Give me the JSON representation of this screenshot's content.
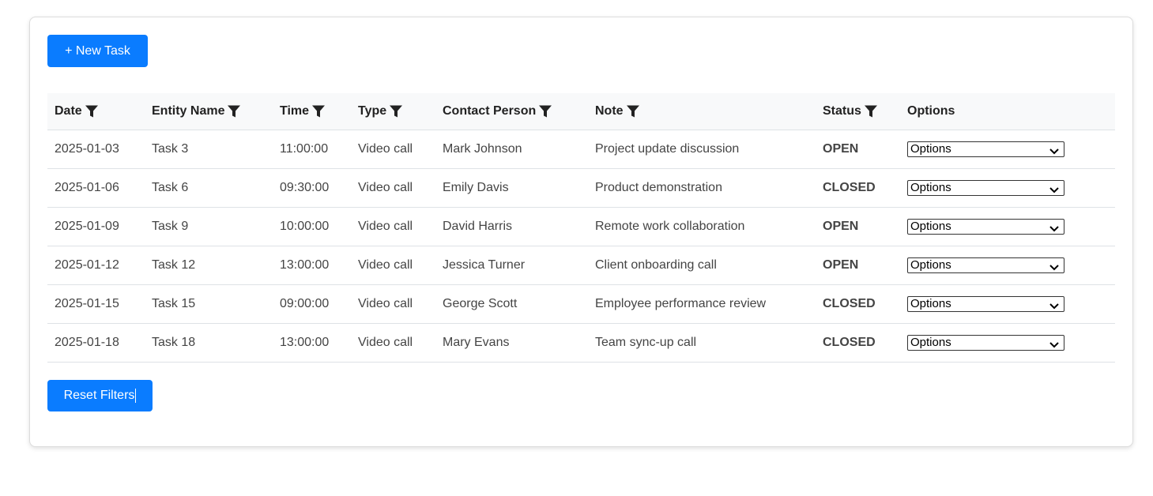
{
  "toolbar": {
    "new_task_label": "+ New Task",
    "reset_label": "Reset Filters"
  },
  "table": {
    "headers": [
      {
        "label": "Date",
        "filter": true
      },
      {
        "label": "Entity Name",
        "filter": true
      },
      {
        "label": "Time",
        "filter": true
      },
      {
        "label": "Type",
        "filter": true
      },
      {
        "label": "Contact Person",
        "filter": true
      },
      {
        "label": "Note",
        "filter": true
      },
      {
        "label": "Status",
        "filter": true
      },
      {
        "label": "Options",
        "filter": false
      }
    ],
    "rows": [
      {
        "date": "2025-01-03",
        "entity": "Task 3",
        "time": "11:00:00",
        "type": "Video call",
        "contact": "Mark Johnson",
        "note": "Project update discussion",
        "status": "OPEN",
        "option": "Options"
      },
      {
        "date": "2025-01-06",
        "entity": "Task 6",
        "time": "09:30:00",
        "type": "Video call",
        "contact": "Emily Davis",
        "note": "Product demonstration",
        "status": "CLOSED",
        "option": "Options"
      },
      {
        "date": "2025-01-09",
        "entity": "Task 9",
        "time": "10:00:00",
        "type": "Video call",
        "contact": "David Harris",
        "note": "Remote work collaboration",
        "status": "OPEN",
        "option": "Options"
      },
      {
        "date": "2025-01-12",
        "entity": "Task 12",
        "time": "13:00:00",
        "type": "Video call",
        "contact": "Jessica Turner",
        "note": "Client onboarding call",
        "status": "OPEN",
        "option": "Options"
      },
      {
        "date": "2025-01-15",
        "entity": "Task 15",
        "time": "09:00:00",
        "type": "Video call",
        "contact": "George Scott",
        "note": "Employee performance review",
        "status": "CLOSED",
        "option": "Options"
      },
      {
        "date": "2025-01-18",
        "entity": "Task 18",
        "time": "13:00:00",
        "type": "Video call",
        "contact": "Mary Evans",
        "note": "Team sync-up call",
        "status": "CLOSED",
        "option": "Options"
      }
    ]
  },
  "colors": {
    "accent": "#0a7cff",
    "header_bg": "#f8f9fa",
    "border": "#dee2e6"
  },
  "icons": {
    "filter": "filter-icon",
    "dropdown": "chevron-down-icon"
  }
}
